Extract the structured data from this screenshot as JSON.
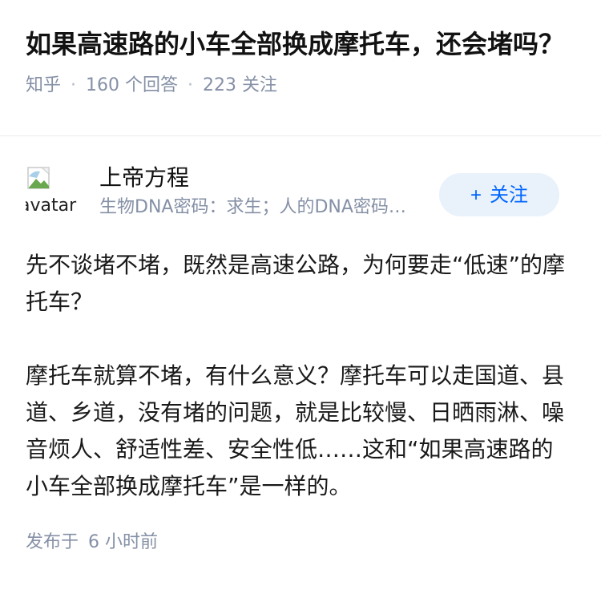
{
  "question": {
    "title": "如果高速路的小车全部换成摩托车，还会堵吗？",
    "source": "知乎",
    "answer_count": "160",
    "answer_unit": "个回答",
    "follower_count": "223",
    "follower_unit": "关注"
  },
  "answer": {
    "author": {
      "name": "上帝方程",
      "bio": "生物DNA密码：求生；人的DNA密码：求生、求知、求爱",
      "avatar_alt": "avatar"
    },
    "follow_button": {
      "icon": "+",
      "label": "关注"
    },
    "paragraphs": [
      "先不谈堵不堵，既然是高速公路，为何要走“低速”的摩托车？",
      "摩托车就算不堵，有什么意义？摩托车可以走国道、县道、乡道，没有堵的问题，就是比较慢、日晒雨淋、噪音烦人、舒适性差、安全性低……这和“如果高速路的小车全部换成摩托车”是一样的。"
    ],
    "published_prefix": "发布于",
    "published_time": "6 小时前"
  }
}
